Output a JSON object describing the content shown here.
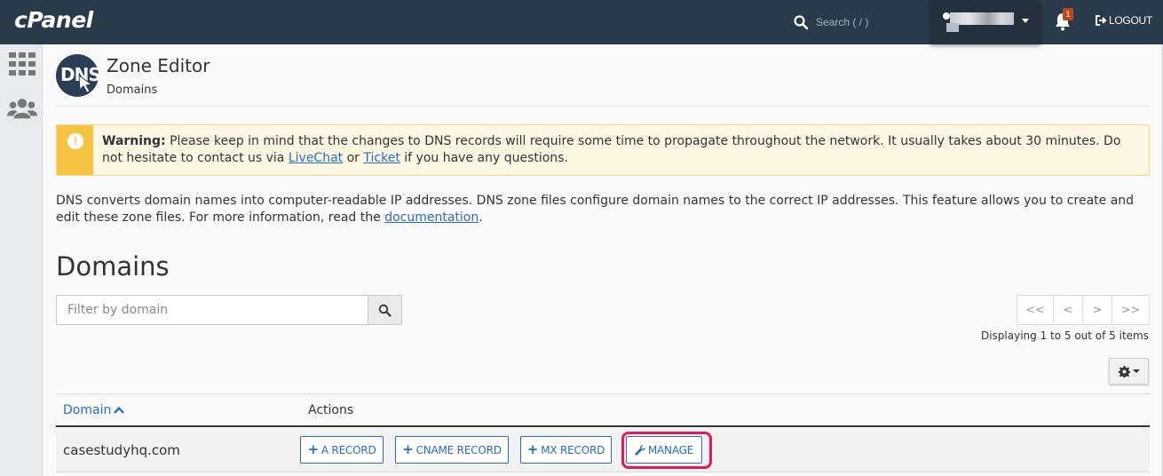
{
  "app": {
    "logo": "cPanel"
  },
  "topbar": {
    "search_placeholder": "Search ( / )",
    "notification_count": "1",
    "logout_label": "LOGOUT"
  },
  "header": {
    "badge": "DNS",
    "title": "Zone Editor",
    "breadcrumb": "Domains"
  },
  "warning": {
    "label": "Warning:",
    "text_before": " Please keep in mind that the changes to DNS records will require some time to propagate throughout the network. It usually takes about 30 minutes. Do not hesitate to contact us via ",
    "link1": "LiveChat",
    "text_mid": " or ",
    "link2": "Ticket",
    "text_after": " if you have any questions."
  },
  "intro": {
    "text": "DNS converts domain names into computer-readable IP addresses. DNS zone files configure domain names to the correct IP addresses. This feature allows you to create and edit these zone files. For more information, read the ",
    "link": "documentation",
    "end": "."
  },
  "section": {
    "title": "Domains"
  },
  "filter": {
    "placeholder": "Filter by domain"
  },
  "pagination": {
    "buttons": [
      "<<",
      "<",
      ">",
      ">>"
    ],
    "info": "Displaying 1 to 5 out of 5 items"
  },
  "table": {
    "headers": {
      "domain": "Domain",
      "actions": "Actions"
    },
    "rows": [
      {
        "domain": "casestudyhq.com",
        "actions": {
          "a_record": "A RECORD",
          "cname_record": "CNAME RECORD",
          "mx_record": "MX RECORD",
          "manage": "MANAGE"
        }
      }
    ]
  },
  "colors": {
    "topbar": "#293a4a",
    "link": "#2a6ac2",
    "warning_strip": "#f6c342",
    "highlight": "#e0195c"
  }
}
